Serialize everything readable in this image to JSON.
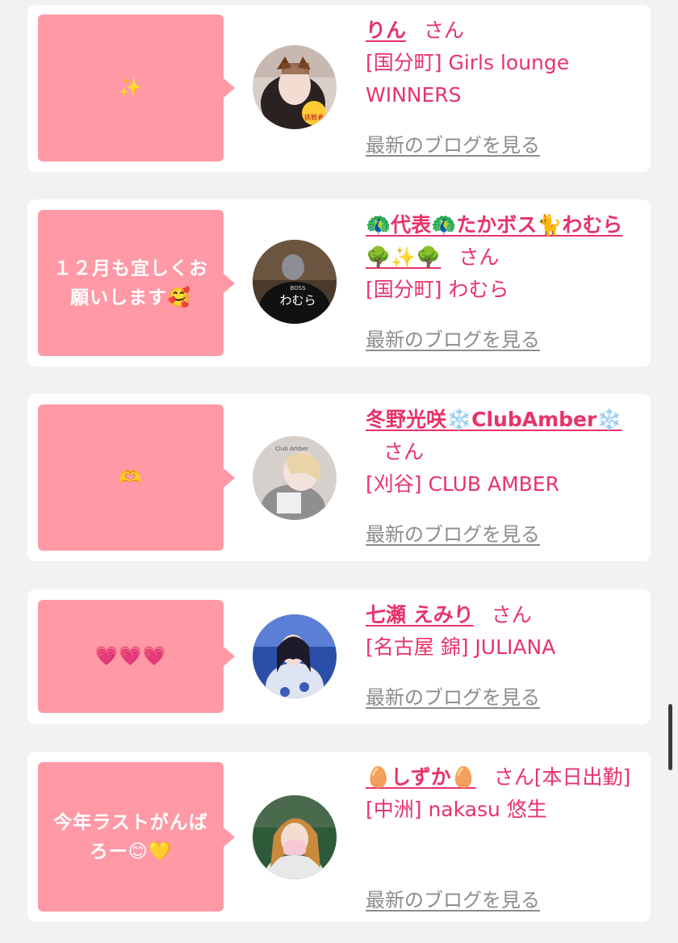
{
  "cards": [
    {
      "message": "✨",
      "name": "りん",
      "honorific": "さん",
      "shop": "[国分町] Girls lounge WINNERS",
      "blog_link": "最新のブログを見る",
      "avatar_badge": "挑戦者"
    },
    {
      "message": "１２月も宜しくお願いします🥰",
      "name": "🦚代表🦚たかボス🐈わむら🌳✨🌳",
      "honorific": "さん",
      "shop": "[国分町] わむら",
      "blog_link": "最新のブログを見る",
      "avatar_badge": "わむら",
      "avatar_badge_small": "BOSS"
    },
    {
      "message": "🫶",
      "name": "冬野光咲❄️ClubAmber❄️",
      "honorific": "さん",
      "shop": "[刈谷] CLUB AMBER",
      "blog_link": "最新のブログを見る",
      "avatar_badge": "Club Amber"
    },
    {
      "message": "💗💗💗",
      "name": "七瀬 えみり",
      "honorific": "さん",
      "shop": "[名古屋 錦] JULIANA",
      "blog_link": "最新のブログを見る"
    },
    {
      "message": "今年ラストがんばろー😊💛",
      "name": "🥚しずか🥚",
      "honorific": "さん[本日出勤]",
      "shop": "[中洲] nakasu 悠生",
      "blog_link": "最新のブログを見る"
    }
  ]
}
